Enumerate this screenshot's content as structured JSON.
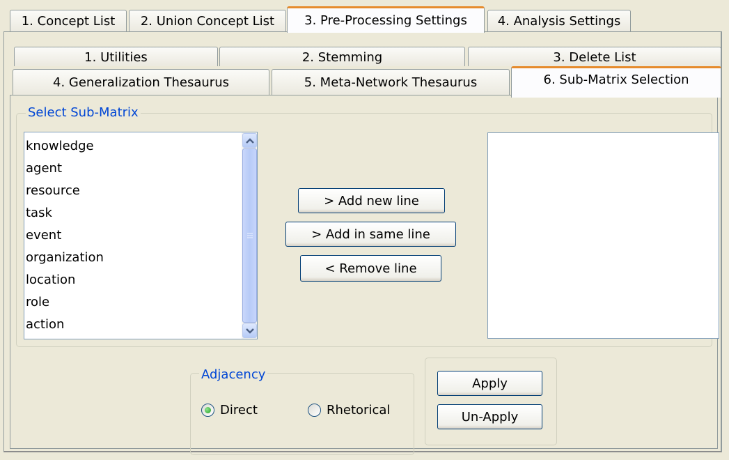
{
  "top_tabs": [
    {
      "label": "1. Concept List"
    },
    {
      "label": "2. Union Concept List"
    },
    {
      "label": "3. Pre-Processing Settings",
      "active": true
    },
    {
      "label": "4. Analysis Settings"
    }
  ],
  "sub_tabs_row1": [
    {
      "label": "1. Utilities"
    },
    {
      "label": "2. Stemming"
    },
    {
      "label": "3. Delete List"
    }
  ],
  "sub_tabs_row2": [
    {
      "label": "4. Generalization Thesaurus"
    },
    {
      "label": "5. Meta-Network Thesaurus"
    },
    {
      "label": "6. Sub-Matrix Selection",
      "active": true
    }
  ],
  "sub_matrix": {
    "title": "Select Sub-Matrix",
    "items": [
      "knowledge",
      "agent",
      "resource",
      "task",
      "event",
      "organization",
      "location",
      "role",
      "action"
    ],
    "buttons": {
      "add_new_line": "> Add new line",
      "add_same_line": "> Add in same line",
      "remove_line": "< Remove line"
    }
  },
  "adjacency": {
    "title": "Adjacency",
    "options": [
      "Direct",
      "Rhetorical"
    ],
    "selected": "Direct"
  },
  "actions": {
    "apply": "Apply",
    "unapply": "Un-Apply"
  },
  "icons": {
    "scroll_up": "chevron-up-icon",
    "scroll_down": "chevron-down-icon",
    "scroll_grip": "grip-icon"
  },
  "colors": {
    "active_tab_accent": "#e68b2c",
    "group_title": "#0046d5",
    "panel_bg": "#ece9d8"
  }
}
